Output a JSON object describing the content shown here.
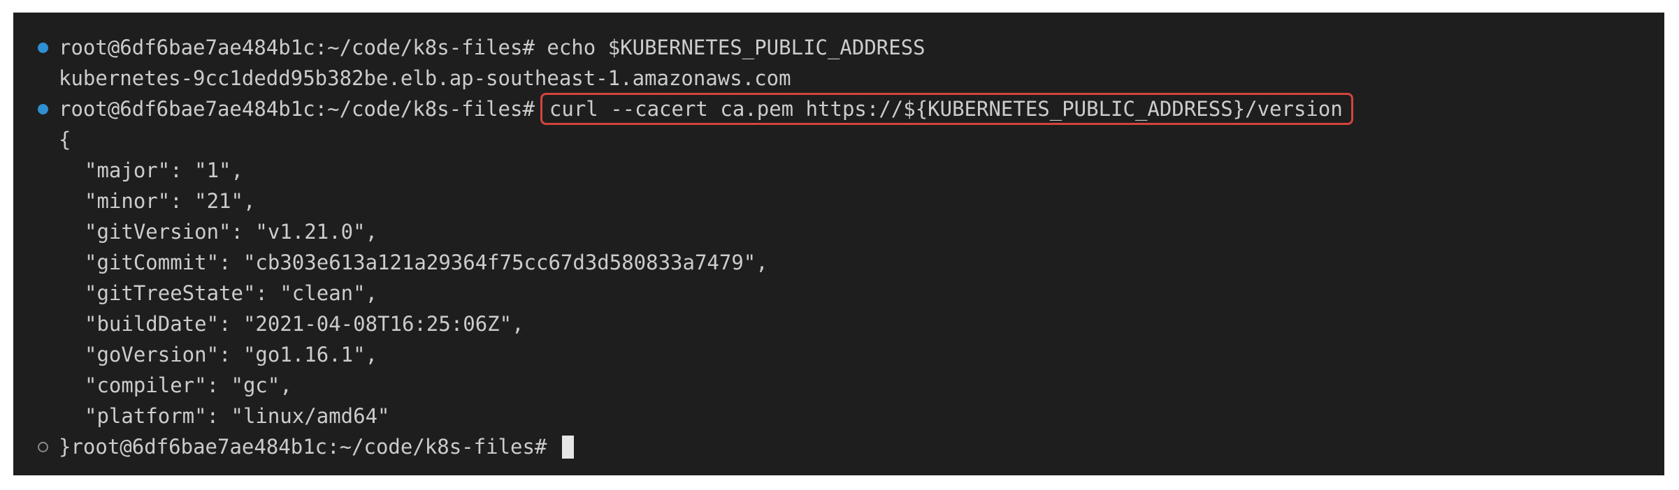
{
  "terminal": {
    "prompt": "root@6df6bae7ae484b1c:~/code/k8s-files#",
    "command_1": "echo $KUBERNETES_PUBLIC_ADDRESS",
    "output_1": "kubernetes-9cc1dedd95b382be.elb.ap-southeast-1.amazonaws.com",
    "command_2": "curl --cacert ca.pem https://${KUBERNETES_PUBLIC_ADDRESS}/version",
    "json_open": "{",
    "json_lines": [
      "\"major\": \"1\",",
      "\"minor\": \"21\",",
      "\"gitVersion\": \"v1.21.0\",",
      "\"gitCommit\": \"cb303e613a121a29364f75cc67d3d580833a7479\",",
      "\"gitTreeState\": \"clean\",",
      "\"buildDate\": \"2021-04-08T16:25:06Z\",",
      "\"goVersion\": \"go1.16.1\",",
      "\"compiler\": \"gc\",",
      "\"platform\": \"linux/amd64\""
    ],
    "json_close": "}",
    "colors": {
      "background": "#1e1e1e",
      "text": "#cccccc",
      "success_marker": "#2f8fd3",
      "highlight_border": "#d2453b"
    }
  }
}
